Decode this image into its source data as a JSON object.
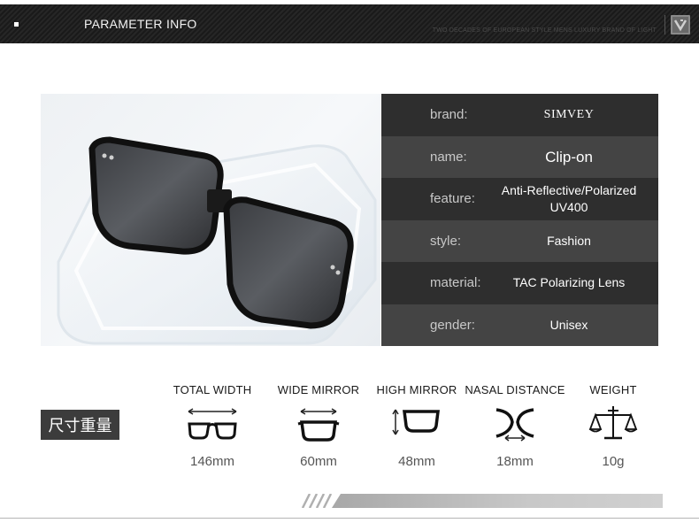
{
  "header": {
    "title": "PARAMETER INFO",
    "tagline": "TWO DECADES OF EUROPEAN STYLE MENS LUXURY BRAND OF LIGHT",
    "logo_icon": "brand-logo-icon"
  },
  "params": [
    {
      "label": "brand:",
      "value": "SIMVEY"
    },
    {
      "label": "name:",
      "value": "Clip-on"
    },
    {
      "label": "feature:",
      "value": "Anti-Reflective/Polarized UV400"
    },
    {
      "label": "style:",
      "value": "Fashion"
    },
    {
      "label": "material:",
      "value": "TAC Polarizing Lens"
    },
    {
      "label": "gender:",
      "value": "Unisex"
    }
  ],
  "size_label": "尺寸重量",
  "dimensions": [
    {
      "name": "TOTAL WIDTH",
      "value": "146mm",
      "icon": "total-width-icon"
    },
    {
      "name": "WIDE MIRROR",
      "value": "60mm",
      "icon": "wide-mirror-icon"
    },
    {
      "name": "HIGH MIRROR",
      "value": "48mm",
      "icon": "high-mirror-icon"
    },
    {
      "name": "NASAL DISTANCE",
      "value": "18mm",
      "icon": "nasal-distance-icon"
    },
    {
      "name": "WEIGHT",
      "value": "10g",
      "icon": "weight-scale-icon"
    }
  ],
  "colors": {
    "header_bg": "#1f1f1f",
    "row_dark": "#2e2e2e",
    "row_light": "#444444",
    "badge_bg": "#3c3c3c"
  }
}
